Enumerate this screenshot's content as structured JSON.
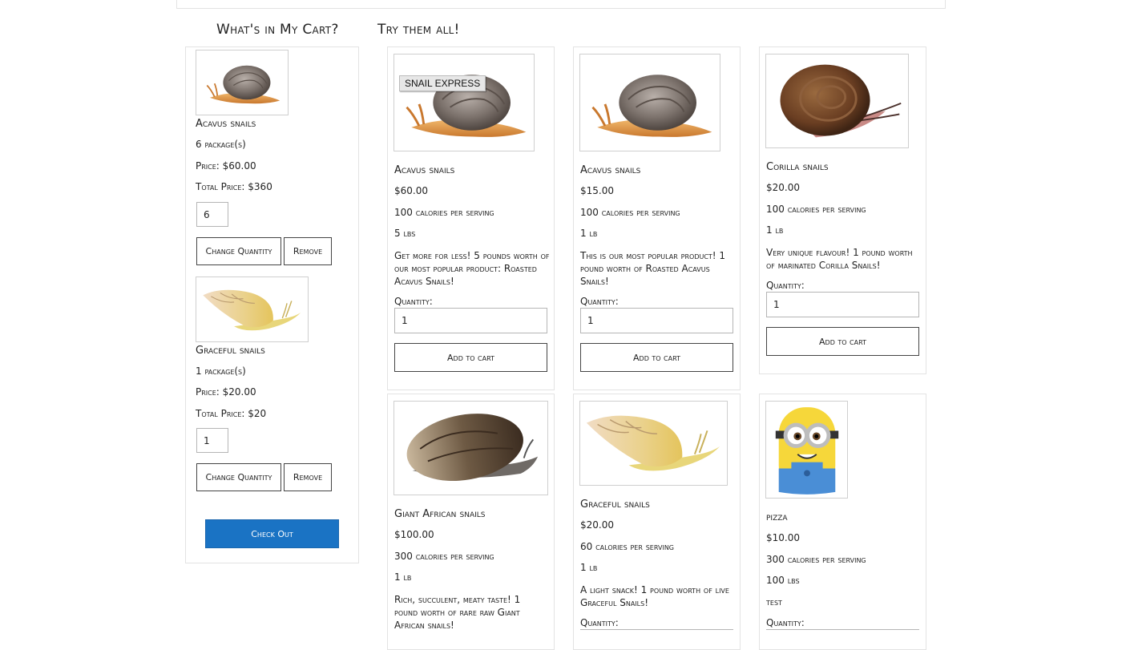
{
  "cart": {
    "heading": "What's in My Cart?",
    "items": [
      {
        "name": "Acavus snails",
        "packages": "6 package(s)",
        "price": "Price: $60.00",
        "total": "Total Price: $360",
        "quantity": "6",
        "change_label": "Change Quantity",
        "remove_label": "Remove",
        "image_icon": "acavus-snail-image"
      },
      {
        "name": "Graceful snails",
        "packages": "1 package(s)",
        "price": "Price: $20.00",
        "total": "Total Price: $20",
        "quantity": "1",
        "change_label": "Change Quantity",
        "remove_label": "Remove",
        "image_icon": "graceful-snail-image"
      }
    ],
    "checkout_label": "Check Out"
  },
  "catalog": {
    "heading": "Try them all!",
    "quantity_label": "Quantity:",
    "add_label": "Add to cart",
    "products": [
      {
        "name": "Acavus snails",
        "price": "$60.00",
        "calories": "100 calories per serving",
        "weight": "5 lbs",
        "description": "Get more for less! 5 pounds worth of our most popular product: Roasted Acavus Snails!",
        "quantity": "1",
        "badge": "SNAIL EXPRESS",
        "image_icon": "acavus-snail-image"
      },
      {
        "name": "Acavus snails",
        "price": "$15.00",
        "calories": "100 calories per serving",
        "weight": "1 lb",
        "description": "This is our most popular product! 1 pound worth of Roasted Acavus Snails!",
        "quantity": "1",
        "image_icon": "acavus-snail-image"
      },
      {
        "name": "Corilla snails",
        "price": "$20.00",
        "calories": "100 calories per serving",
        "weight": "1 lb",
        "description": "Very unique flavour! 1 pound worth of marinated Corilla Snails!",
        "quantity": "1",
        "image_icon": "corilla-snail-image"
      },
      {
        "name": "Giant African snails",
        "price": "$100.00",
        "calories": "300 calories per serving",
        "weight": "1 lb",
        "description": "Rich, succulent, meaty taste! 1 pound worth of rare raw Giant African snails!",
        "image_icon": "giant-african-snail-image"
      },
      {
        "name": "Graceful snails",
        "price": "$20.00",
        "calories": "60 calories per serving",
        "weight": "1 lb",
        "description": "A light snack! 1 pound worth of live Graceful Snails!",
        "image_icon": "graceful-snail-image"
      },
      {
        "name": "pizza",
        "price": "$10.00",
        "calories": "300 calories per serving",
        "weight": "100 lbs",
        "description": "test",
        "image_icon": "minion-image"
      }
    ]
  },
  "colors": {
    "primary_button": "#1a73c4",
    "border": "#e3e3e3"
  }
}
